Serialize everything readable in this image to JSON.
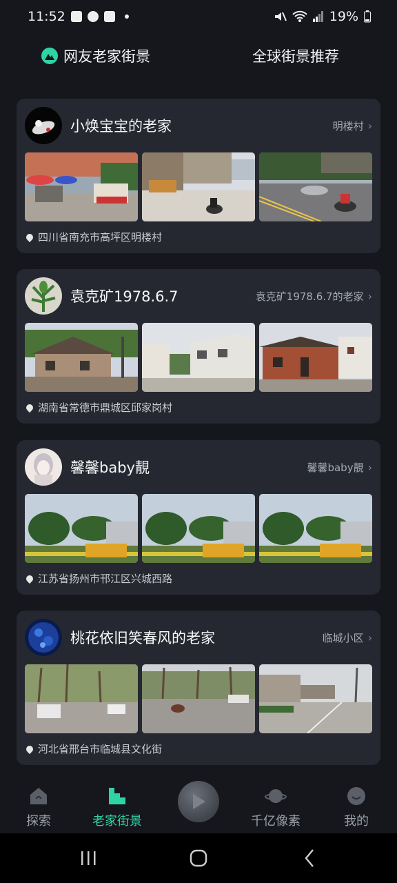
{
  "status_bar": {
    "time": "11:52",
    "battery": "19%"
  },
  "top_tabs": {
    "left_label": "网友老家街景",
    "right_label": "全球街景推荐"
  },
  "cards": [
    {
      "title": "小焕宝宝的老家",
      "link": "明楼村",
      "location": "四川省南充市高坪区明楼村"
    },
    {
      "title": "袁克矿1978.6.7",
      "link": "袁克矿1978.6.7的老家",
      "location": "湖南省常德市鼎城区邱家岗村"
    },
    {
      "title": "馨馨baby靚",
      "link": "馨馨baby靚",
      "location": "江苏省扬州市邗江区兴城西路"
    },
    {
      "title": "桃花依旧笑春风的老家",
      "link": "临城小区",
      "location": "河北省邢台市临城县文化街"
    }
  ],
  "bottom_nav": {
    "explore": "探索",
    "hometown": "老家街景",
    "pixels": "千亿像素",
    "mine": "我的"
  },
  "colors": {
    "accent": "#2fd4a4",
    "background": "#15171c",
    "card": "#252830"
  }
}
